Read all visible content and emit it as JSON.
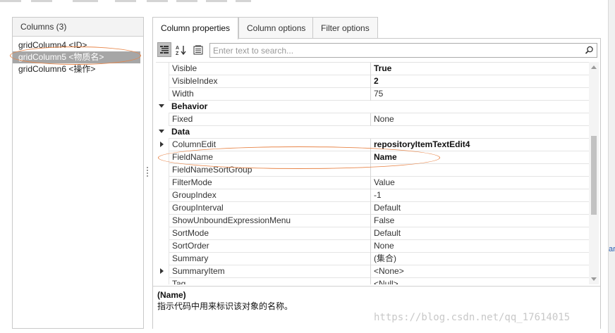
{
  "left_panel": {
    "header": "Columns (3)",
    "columns": [
      {
        "label": "gridColumn4 <ID>",
        "selected": false
      },
      {
        "label": "gridColumn5 <物质名>",
        "selected": true
      },
      {
        "label": "gridColumn6 <操作>",
        "selected": false
      }
    ]
  },
  "tabs": [
    {
      "label": "Column properties",
      "active": true
    },
    {
      "label": "Column options",
      "active": false
    },
    {
      "label": "Filter options",
      "active": false
    }
  ],
  "toolbar": {
    "buttons": [
      {
        "icon": "categorized-icon",
        "active": true
      },
      {
        "icon": "sort-alphabetical-icon",
        "active": false
      },
      {
        "icon": "property-pages-icon",
        "active": false
      }
    ],
    "search_placeholder": "Enter text to search..."
  },
  "properties": [
    {
      "kind": "prop",
      "name": "Visible",
      "value": "True",
      "bold": true
    },
    {
      "kind": "prop",
      "name": "VisibleIndex",
      "value": "2",
      "bold": true
    },
    {
      "kind": "prop",
      "name": "Width",
      "value": "75",
      "bold": false
    },
    {
      "kind": "category",
      "name": "Behavior",
      "expander": "down"
    },
    {
      "kind": "prop",
      "name": "Fixed",
      "value": "None",
      "bold": false
    },
    {
      "kind": "category",
      "name": "Data",
      "expander": "down"
    },
    {
      "kind": "prop",
      "name": "ColumnEdit",
      "value": "repositoryItemTextEdit4",
      "bold": true,
      "expander": "right"
    },
    {
      "kind": "prop",
      "name": "FieldName",
      "value": "Name",
      "bold": true
    },
    {
      "kind": "prop",
      "name": "FieldNameSortGroup",
      "value": "",
      "bold": false
    },
    {
      "kind": "prop",
      "name": "FilterMode",
      "value": "Value",
      "bold": false
    },
    {
      "kind": "prop",
      "name": "GroupIndex",
      "value": "-1",
      "bold": false
    },
    {
      "kind": "prop",
      "name": "GroupInterval",
      "value": "Default",
      "bold": false
    },
    {
      "kind": "prop",
      "name": "ShowUnboundExpressionMenu",
      "value": "False",
      "bold": false
    },
    {
      "kind": "prop",
      "name": "SortMode",
      "value": "Default",
      "bold": false
    },
    {
      "kind": "prop",
      "name": "SortOrder",
      "value": "None",
      "bold": false
    },
    {
      "kind": "prop",
      "name": "Summary",
      "value": "(集合)",
      "bold": false
    },
    {
      "kind": "prop",
      "name": "SummaryItem",
      "value": "<None>",
      "bold": false,
      "expander": "right"
    },
    {
      "kind": "prop",
      "name": "Tag",
      "value": "<Null>",
      "bold": false
    }
  ],
  "description": {
    "title": "(Name)",
    "text": "指示代码中用来标识该对象的名称。"
  },
  "watermark": "https://blog.csdn.net/qq_17614015",
  "right_edge_glyph": "ar",
  "colors": {
    "annotation": "#e8864a",
    "selected_row": "#a6a6a6",
    "border": "#c9c9c9"
  }
}
